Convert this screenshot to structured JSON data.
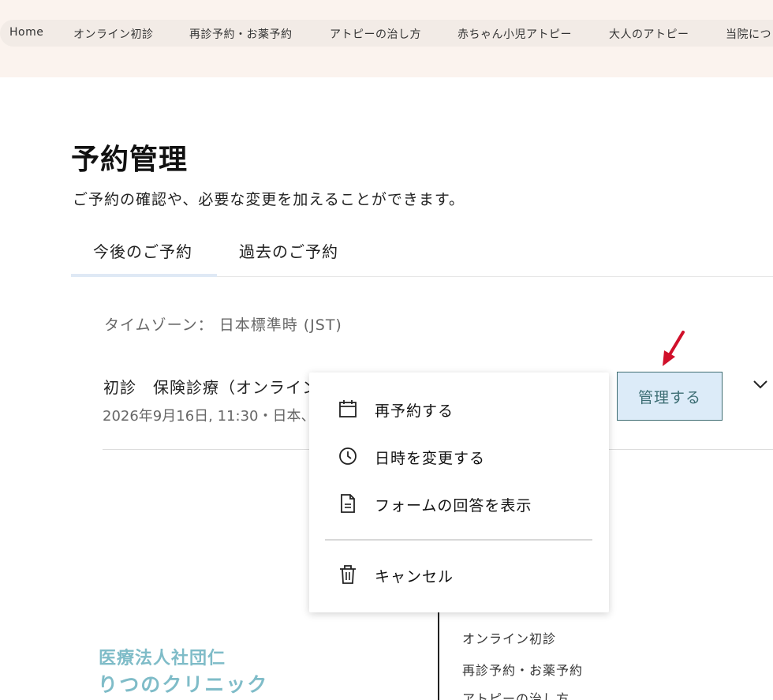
{
  "nav": {
    "items": [
      "Home",
      "オンライン初診",
      "再診予約・お薬予約",
      "アトピーの治し方",
      "赤ちゃん小児アトピー",
      "大人のアトピー",
      "当院につ"
    ]
  },
  "page": {
    "title": "予約管理",
    "subtitle": "ご予約の確認や、必要な変更を加えることができます。"
  },
  "tabs": [
    {
      "label": "今後のご予約",
      "active": true
    },
    {
      "label": "過去のご予約",
      "active": false
    }
  ],
  "timezone_text": "タイムゾーン：  日本標準時 (JST)",
  "appointment": {
    "title": "初診　保険診療（オンライン",
    "datetime": "2026年9月16日, 11:30・日本、",
    "manage_label": "管理する"
  },
  "menu": {
    "items": [
      {
        "label": "再予約する",
        "icon": "calendar-icon"
      },
      {
        "label": "日時を変更する",
        "icon": "clock-icon"
      },
      {
        "label": "フォームの回答を表示",
        "icon": "document-icon"
      },
      {
        "label": "キャンセル",
        "icon": "trash-icon"
      }
    ]
  },
  "footer": {
    "clinic_name_line1": "医療法人社団仁",
    "clinic_name_line2": "りつのクリニック",
    "links": [
      "オンライン初診",
      "再診予約・お薬予約",
      "アトピーの治し方"
    ]
  },
  "colors": {
    "accent": "#3d6e74",
    "manage_bg": "#dcebf8",
    "clinic_teal": "#7fbcc8",
    "annotation_arrow": "#d0102a",
    "topbar_bg": "#fbf3ee"
  }
}
